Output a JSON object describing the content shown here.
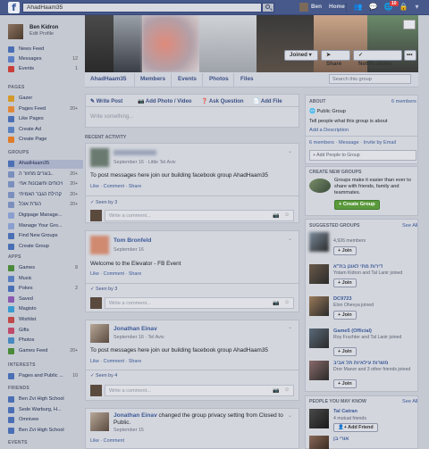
{
  "topbar": {
    "search": "AhadHaam35",
    "user": "Ben",
    "home": "Home",
    "notif_count": "10"
  },
  "sidebar": {
    "name": "Ben Kidron",
    "edit": "Edit Profile",
    "top": [
      {
        "label": "News Feed",
        "count": "",
        "color": "#4a6fb5"
      },
      {
        "label": "Messages",
        "count": "12",
        "color": "#5b7ec5"
      },
      {
        "label": "Events",
        "count": "1",
        "color": "#c9403a"
      }
    ],
    "pages_head": "PAGES",
    "pages": [
      {
        "label": "Gazer",
        "count": "",
        "color": "#d39a2a"
      },
      {
        "label": "Pages Feed",
        "count": "20+",
        "color": "#e0883a"
      },
      {
        "label": "Like Pages",
        "count": "",
        "color": "#4a6fb5"
      },
      {
        "label": "Create Ad",
        "count": "",
        "color": "#5a82c0"
      },
      {
        "label": "Create Page",
        "count": "",
        "color": "#e07b2a"
      }
    ],
    "groups_head": "GROUPS",
    "groups": [
      {
        "label": "AhadHaam35",
        "count": "",
        "color": "#4a6fb5"
      },
      {
        "label": "בוגרים מחזור ה..",
        "count": "20+",
        "color": "#7a8fbd"
      },
      {
        "label": "ויכוחים וחשבונות אחי",
        "count": "20+",
        "color": "#7a8fbd"
      },
      {
        "label": "קהילת הגבר האמיתי",
        "count": "20+",
        "color": "#7a8fbd"
      },
      {
        "label": "הגדת אוכל",
        "count": "20+",
        "color": "#7a8fbd"
      },
      {
        "label": "Digipage Manage...",
        "count": "",
        "color": "#8a9fd0"
      },
      {
        "label": "Manage Your Gro...",
        "count": "",
        "color": "#8a9fd0"
      },
      {
        "label": "Find New Groups",
        "count": "",
        "color": "#4a6fb5"
      },
      {
        "label": "Create Group",
        "count": "",
        "color": "#4a6fb5"
      }
    ],
    "apps_head": "APPS",
    "apps": [
      {
        "label": "Games",
        "count": "8",
        "color": "#4a8a3a"
      },
      {
        "label": "Music",
        "count": "",
        "color": "#5a7fc0"
      },
      {
        "label": "Pokes",
        "count": "2",
        "color": "#4a6fb5"
      },
      {
        "label": "Saved",
        "count": "",
        "color": "#8a5ab0"
      },
      {
        "label": "Magisto",
        "count": "",
        "color": "#3a9ad0"
      },
      {
        "label": "Wishlist",
        "count": "",
        "color": "#c04a4a"
      },
      {
        "label": "Gifts",
        "count": "",
        "color": "#c04a6a"
      },
      {
        "label": "Photos",
        "count": "",
        "color": "#4a8ac0"
      },
      {
        "label": "Games Feed",
        "count": "20+",
        "color": "#4a8a3a"
      }
    ],
    "interests_head": "INTERESTS",
    "interests": [
      {
        "label": "Pages and Public ...",
        "count": "10",
        "color": "#4a6fb5"
      }
    ],
    "friends_head": "FRIENDS",
    "friends": [
      {
        "label": "Ben Zvi High School",
        "count": "",
        "color": "#4a6fb5"
      },
      {
        "label": "Sede Warburg, H...",
        "count": "",
        "color": "#4a6fb5"
      },
      {
        "label": "Omnivee",
        "count": "",
        "color": "#4a6fb5"
      },
      {
        "label": "Ben Zvi High School",
        "count": "",
        "color": "#4a6fb5"
      }
    ],
    "events_head": "EVENTS"
  },
  "cover": {
    "joined": "Joined",
    "share": "Share",
    "notifications": "Notifications",
    "more": "•••"
  },
  "tabs": {
    "name": "AhadHaam35",
    "members": "Members",
    "events": "Events",
    "photos": "Photos",
    "files": "Files",
    "search_ph": "Search this group"
  },
  "composer": {
    "write": "Write Post",
    "photo": "Add Photo / Video",
    "ask": "Ask Question",
    "file": "Add File",
    "placeholder": "Write something..."
  },
  "recent": "RECENT ACTIVITY",
  "posts": [
    {
      "name": "",
      "meta": "September 16 · Little Tel Aviv",
      "text": "To post messages here join our building facebook group AhadHaam35",
      "actions": "Like · Comment · Share",
      "seen": "Seen by 3",
      "comment": "Write a comment..."
    },
    {
      "name": "Tom Bronfeld",
      "meta": "September 16",
      "text": "Welcome to the Elevator - FB Event",
      "actions": "Like · Comment · Share",
      "seen": "Seen by 3",
      "comment": "Write a comment..."
    },
    {
      "name": "Jonathan Einav",
      "meta": "September 16 · Tel Aviv",
      "text": "To post messages here join our building facebook group AhadHaam35",
      "actions": "Like · Comment · Share",
      "seen": "Seen by 4",
      "comment": "Write a comment..."
    },
    {
      "name": "Jonathan Einav",
      "action": " changed the group privacy setting from Closed to Public.",
      "meta": "September 15",
      "actions": "Like · Comment"
    }
  ],
  "right": {
    "about_head": "ABOUT",
    "members_count": "6 members",
    "privacy": "Public Group",
    "tell": "Tell people what this group is about",
    "add_desc": "Add a Description",
    "member_links": "6 members · Message · Invite by Email",
    "add_people": "+ Add People to Group",
    "create_head": "CREATE NEW GROUPS",
    "create_text": "Groups make it easier than ever to share with friends, family and teammates.",
    "create_btn": "+ Create Group",
    "sugg_head": "SUGGESTED GROUPS",
    "see_all": "See All",
    "sugg": [
      {
        "name": "",
        "sub": "4,926 members",
        "join": "+ Join"
      },
      {
        "name": "דירות מתי לאונן בת\"א",
        "sub": "Yotam Kidron and Tal Lanir joined",
        "join": "+ Join"
      },
      {
        "name": "DC9723",
        "sub": "Elon Ohevya joined",
        "join": "+ Join"
      },
      {
        "name": "Game5 (Official)",
        "sub": "Roy Fruchter and Tal Lanir joined",
        "join": "+ Join"
      },
      {
        "name": "משרות עילאיות תל אביב",
        "sub": "Dror Manor and 3 other friends joined",
        "join": "+ Join"
      }
    ],
    "pymk_head": "PEOPLE YOU MAY KNOW",
    "pymk": [
      {
        "name": "Tal Catran",
        "sub": "4 mutual friends",
        "btn": "Add Friend"
      },
      {
        "name": "אורי בן",
        "sub": "",
        "btn": ""
      }
    ]
  }
}
